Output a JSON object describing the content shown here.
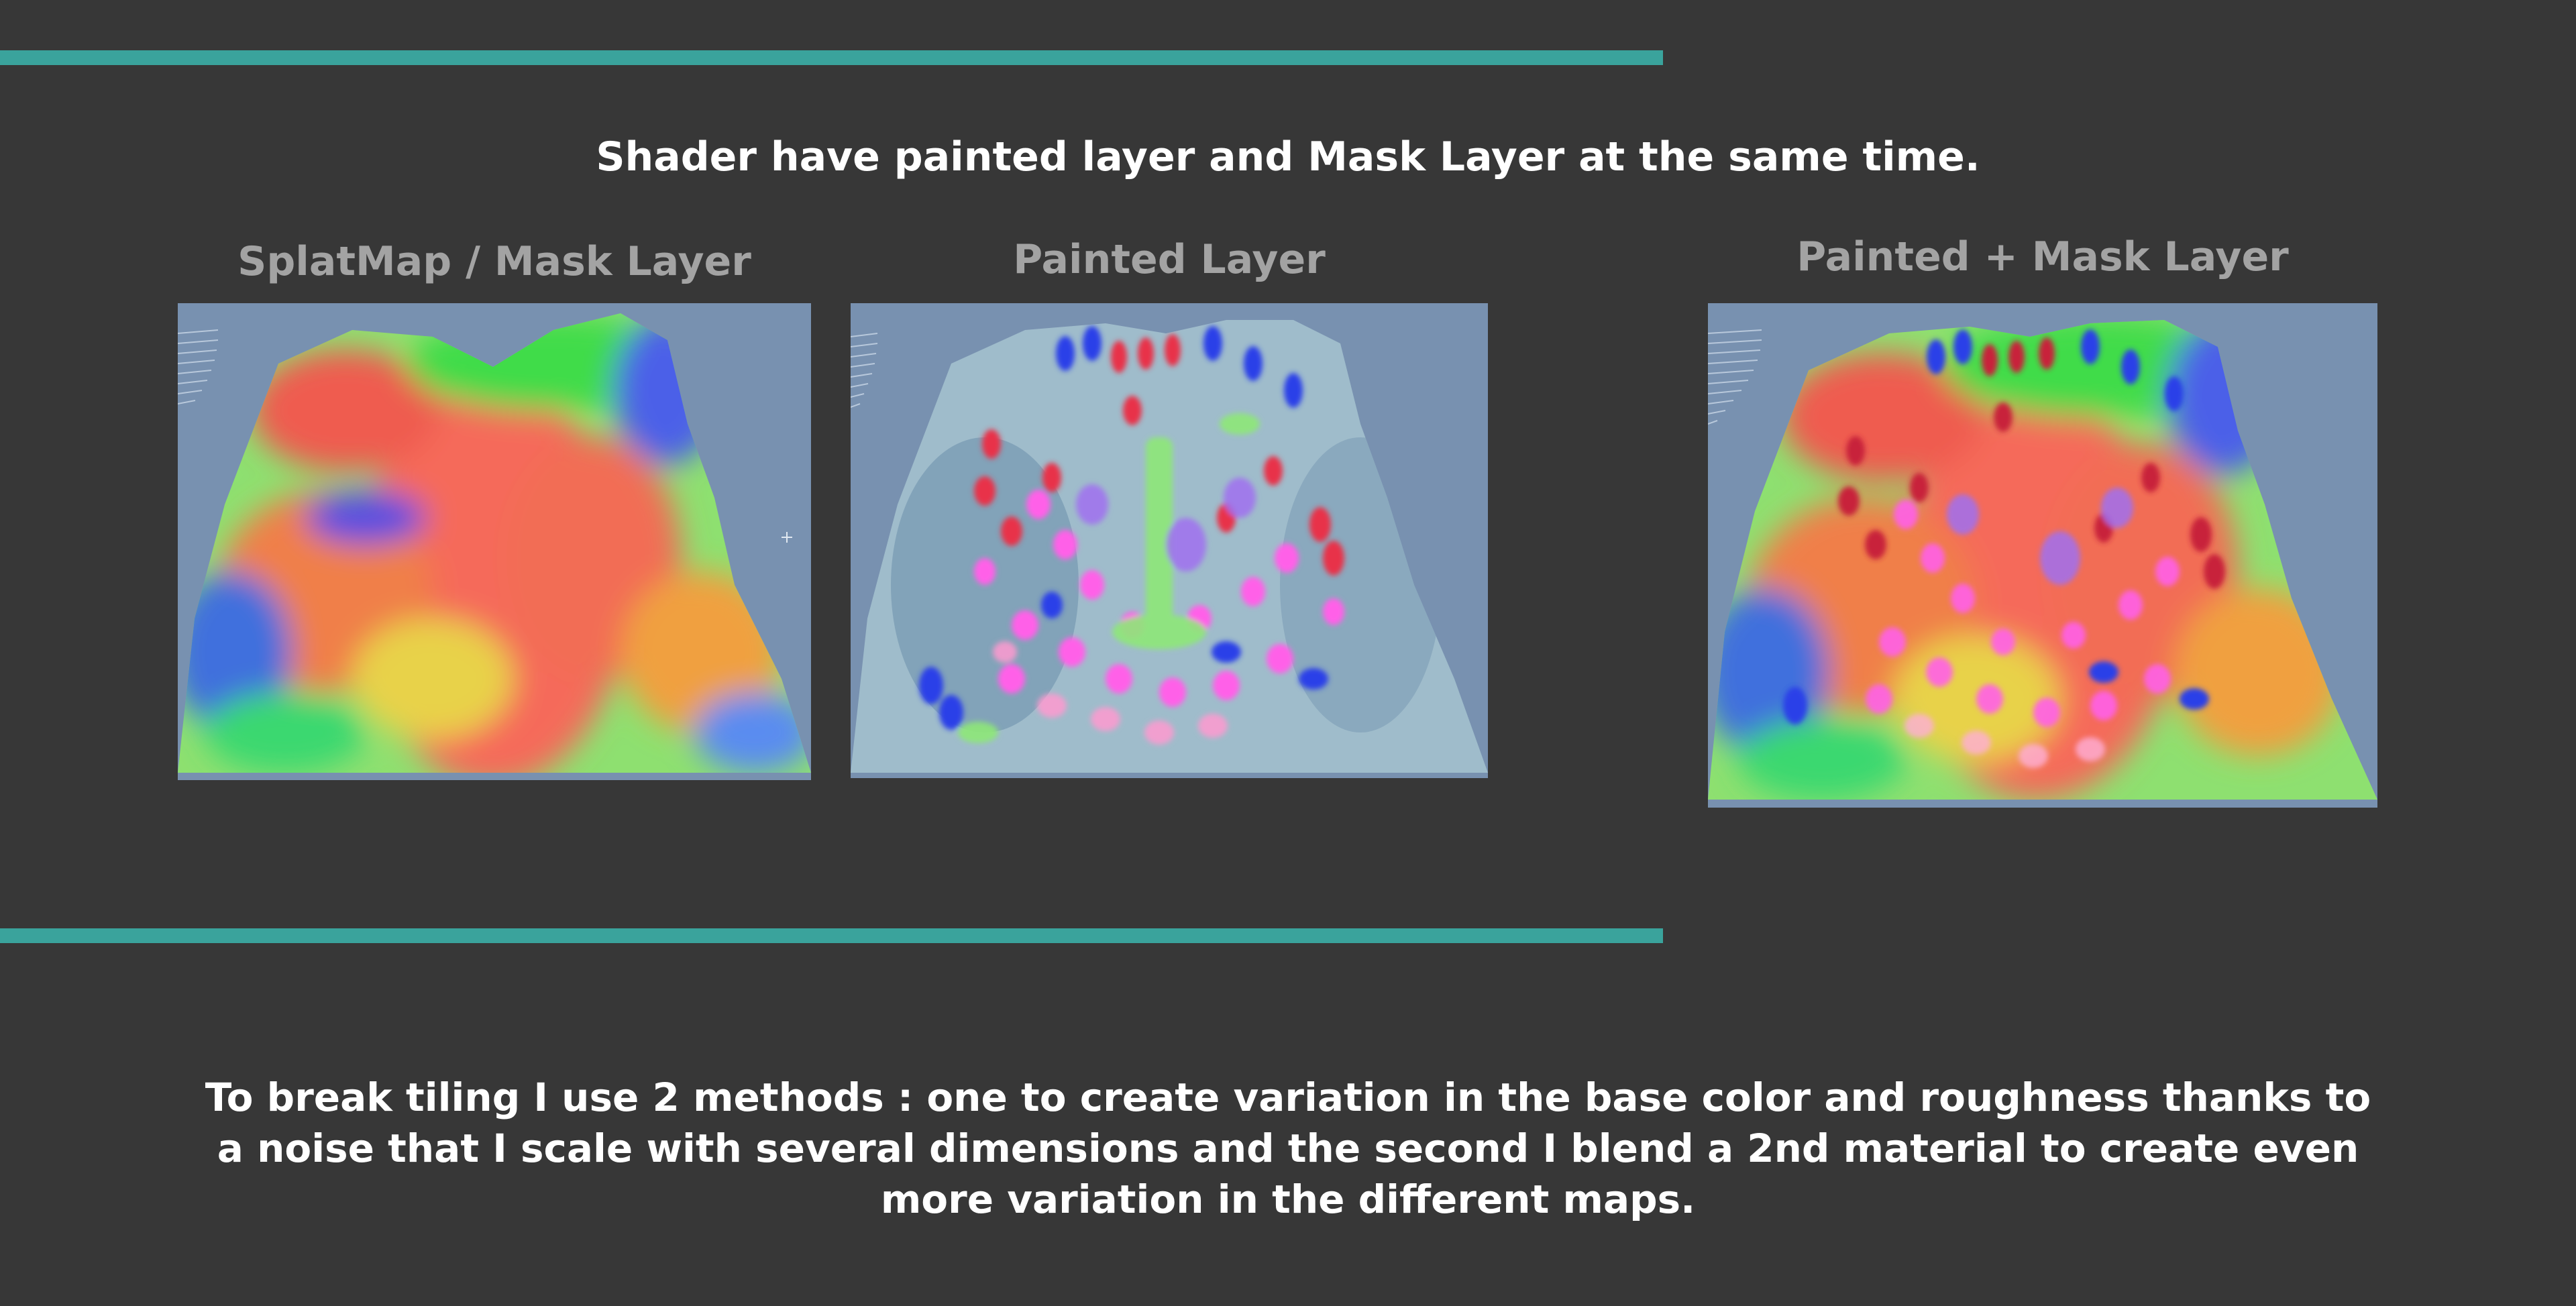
{
  "headline": "Shader have painted layer and Mask Layer at the same time.",
  "panels": [
    {
      "caption": "SplatMap / Mask Layer"
    },
    {
      "caption": "Painted Layer"
    },
    {
      "caption": "Painted + Mask Layer"
    }
  ],
  "footer": {
    "line1": "To break tiling I use 2 methods : one to create variation in the base color and roughness thanks to",
    "line2": "a noise that I scale with several dimensions and the second I blend a 2nd material to create even",
    "line3": "more variation in the different maps."
  },
  "colors": {
    "background": "#373737",
    "accent_rule": "#3aa39c",
    "viewport_sky": "#7891b0"
  }
}
